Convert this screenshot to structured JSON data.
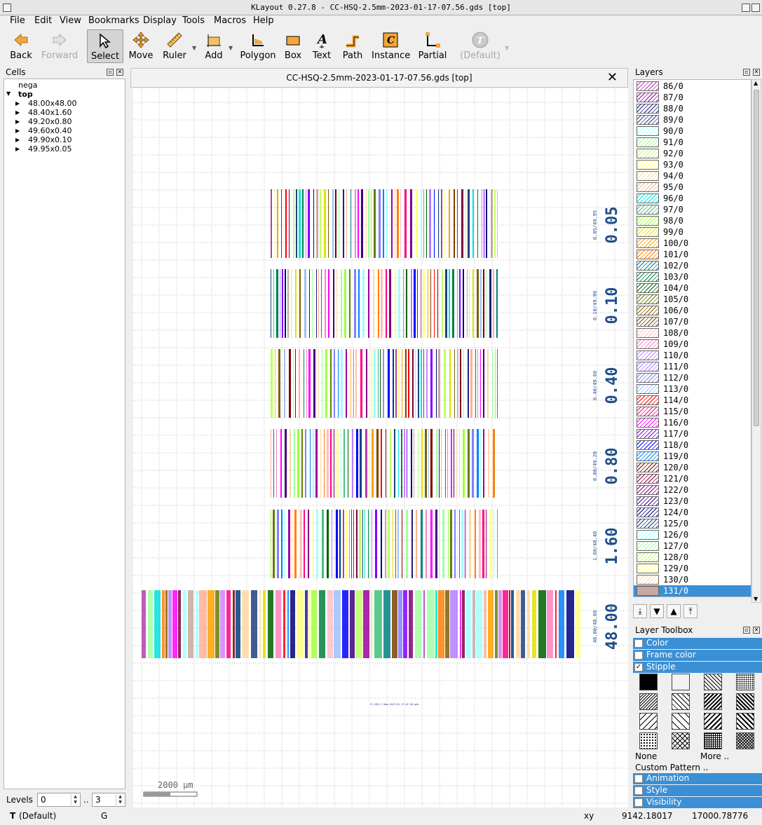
{
  "window": {
    "title": "KLayout 0.27.8 - CC-HSQ-2.5mm-2023-01-17-07.56.gds [top]"
  },
  "menu": [
    "File",
    "Edit",
    "View",
    "Bookmarks",
    "Display",
    "Tools",
    "Macros",
    "Help"
  ],
  "toolbar": [
    {
      "label": "Back",
      "icon": "back-arrow-icon",
      "state": "normal"
    },
    {
      "label": "Forward",
      "icon": "forward-arrow-icon",
      "state": "disabled"
    },
    {
      "label": "Select",
      "icon": "select-cursor-icon",
      "state": "selected"
    },
    {
      "label": "Move",
      "icon": "move-icon",
      "state": "normal"
    },
    {
      "label": "Ruler",
      "icon": "ruler-icon",
      "state": "normal"
    },
    {
      "label": "Add",
      "icon": "add-ruler-icon",
      "state": "normal"
    },
    {
      "label": "Polygon",
      "icon": "polygon-icon",
      "state": "normal"
    },
    {
      "label": "Box",
      "icon": "box-icon",
      "state": "normal"
    },
    {
      "label": "Text",
      "icon": "text-icon",
      "state": "normal"
    },
    {
      "label": "Path",
      "icon": "path-icon",
      "state": "normal"
    },
    {
      "label": "Instance",
      "icon": "instance-icon",
      "state": "normal"
    },
    {
      "label": "Partial",
      "icon": "partial-icon",
      "state": "normal"
    },
    {
      "label": "(Default)",
      "icon": "default-text-style-icon",
      "state": "disabled"
    }
  ],
  "cells": {
    "title": "Cells",
    "items": [
      {
        "label": "nega",
        "depth": 0,
        "bold": false,
        "arrow": ""
      },
      {
        "label": "top",
        "depth": 0,
        "bold": true,
        "arrow": "▼"
      },
      {
        "label": "48.00x48.00",
        "depth": 1,
        "bold": false,
        "arrow": "▶"
      },
      {
        "label": "48.40x1.60",
        "depth": 1,
        "bold": false,
        "arrow": "▶"
      },
      {
        "label": "49.20x0.80",
        "depth": 1,
        "bold": false,
        "arrow": "▶"
      },
      {
        "label": "49.60x0.40",
        "depth": 1,
        "bold": false,
        "arrow": "▶"
      },
      {
        "label": "49.90x0.10",
        "depth": 1,
        "bold": false,
        "arrow": "▶"
      },
      {
        "label": "49.95x0.05",
        "depth": 1,
        "bold": false,
        "arrow": "▶"
      }
    ]
  },
  "levels": {
    "label": "Levels",
    "from": "0",
    "sep": "..",
    "to": "3"
  },
  "document": {
    "tab_title": "CC-HSQ-2.5mm-2023-01-17-07.56.gds [top]"
  },
  "canvas": {
    "blocks": [
      {
        "big": "0.05",
        "small": "0.05/49.95"
      },
      {
        "big": "0.10",
        "small": "0.10/49.90"
      },
      {
        "big": "0.40",
        "small": "0.40/49.60"
      },
      {
        "big": "0.80",
        "small": "0.80/49.20"
      },
      {
        "big": "1.60",
        "small": "1.60/48.40"
      },
      {
        "big": "48.00",
        "small": "48.00/48.00"
      }
    ],
    "chip_label": "CC-HSQ-2.5mm-2023-01-17-07.56.gds",
    "scale_bar": "2000 µm"
  },
  "layers": {
    "title": "Layers",
    "items": [
      {
        "name": "86/0",
        "color": "#b33cb3"
      },
      {
        "name": "87/0",
        "color": "#a000a0"
      },
      {
        "name": "88/0",
        "color": "#202080"
      },
      {
        "name": "89/0",
        "color": "#204080"
      },
      {
        "name": "90/0",
        "color": "#a0ffff"
      },
      {
        "name": "91/0",
        "color": "#a0ffa0"
      },
      {
        "name": "92/0",
        "color": "#c0ff60"
      },
      {
        "name": "93/0",
        "color": "#ffff80"
      },
      {
        "name": "94/0",
        "color": "#ffd8a0"
      },
      {
        "name": "95/0",
        "color": "#ffb090"
      },
      {
        "name": "96/0",
        "color": "#00e0e0"
      },
      {
        "name": "97/0",
        "color": "#40c080"
      },
      {
        "name": "98/0",
        "color": "#a0ff40"
      },
      {
        "name": "99/0",
        "color": "#e0e000"
      },
      {
        "name": "100/0",
        "color": "#ffa000"
      },
      {
        "name": "101/0",
        "color": "#ff8000"
      },
      {
        "name": "102/0",
        "color": "#008080"
      },
      {
        "name": "103/0",
        "color": "#008040"
      },
      {
        "name": "104/0",
        "color": "#006000"
      },
      {
        "name": "105/0",
        "color": "#608000"
      },
      {
        "name": "106/0",
        "color": "#806000"
      },
      {
        "name": "107/0",
        "color": "#804000"
      },
      {
        "name": "108/0",
        "color": "#ffc0c0"
      },
      {
        "name": "109/0",
        "color": "#ff80c0"
      },
      {
        "name": "110/0",
        "color": "#d080ff"
      },
      {
        "name": "111/0",
        "color": "#b080ff"
      },
      {
        "name": "112/0",
        "color": "#8080ff"
      },
      {
        "name": "113/0",
        "color": "#a0c0ff"
      },
      {
        "name": "114/0",
        "color": "#ff0000"
      },
      {
        "name": "115/0",
        "color": "#ff0080"
      },
      {
        "name": "116/0",
        "color": "#ff00ff"
      },
      {
        "name": "117/0",
        "color": "#8000ff"
      },
      {
        "name": "118/0",
        "color": "#0000ff"
      },
      {
        "name": "119/0",
        "color": "#0080ff"
      },
      {
        "name": "120/0",
        "color": "#800000"
      },
      {
        "name": "121/0",
        "color": "#800040"
      },
      {
        "name": "122/0",
        "color": "#800080"
      },
      {
        "name": "123/0",
        "color": "#400080"
      },
      {
        "name": "124/0",
        "color": "#000080"
      },
      {
        "name": "125/0",
        "color": "#004080"
      },
      {
        "name": "126/0",
        "color": "#a0ffff"
      },
      {
        "name": "127/0",
        "color": "#a0ffa0"
      },
      {
        "name": "128/0",
        "color": "#c0ff60"
      },
      {
        "name": "129/0",
        "color": "#ffff80"
      },
      {
        "name": "130/0",
        "color": "#ffd8a0"
      },
      {
        "name": "131/0",
        "color": "#c8a8a0"
      }
    ],
    "active": "131/0"
  },
  "toolbox": {
    "title": "Layer Toolbox",
    "sections": [
      {
        "label": "Color",
        "checked": false
      },
      {
        "label": "Frame color",
        "checked": false
      },
      {
        "label": "Stipple",
        "checked": true
      }
    ],
    "none_label": "None",
    "more_label": "More ..",
    "custom_label": "Custom Pattern ..",
    "bottom_sections": [
      {
        "label": "Animation",
        "checked": false
      },
      {
        "label": "Style",
        "checked": false
      },
      {
        "label": "Visibility",
        "checked": false
      }
    ]
  },
  "status": {
    "mode": "T",
    "style": "(Default)",
    "g": "G",
    "xy_label": "xy",
    "x": "9142.18017",
    "y": "17000.78776"
  }
}
